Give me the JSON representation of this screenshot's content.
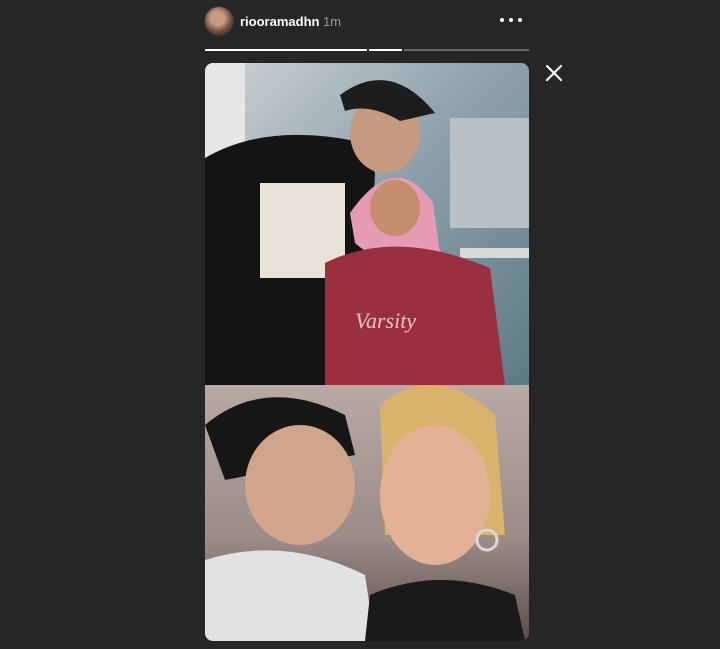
{
  "header": {
    "username": "riooramadhn",
    "timestamp": "1m"
  },
  "progress": {
    "segments": [
      {
        "fill": 1.0
      },
      {
        "fill": 1.0
      },
      {
        "fill": 0.0
      }
    ]
  },
  "icons": {
    "more": "more-horizontal-icon",
    "close": "close-icon"
  },
  "colors": {
    "background": "#262626",
    "text": "#ffffff",
    "muted": "#9a9a9a"
  }
}
